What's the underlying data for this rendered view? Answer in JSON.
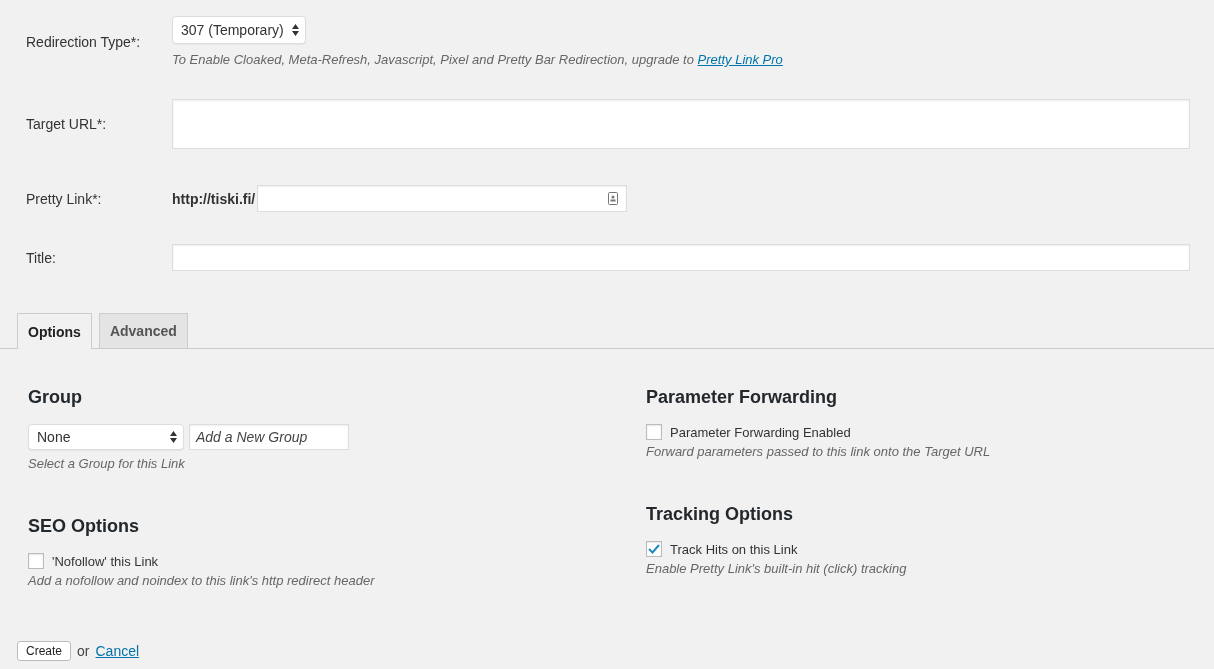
{
  "form": {
    "redirection_type": {
      "label": "Redirection Type*:",
      "value": "307 (Temporary)",
      "help": "To Enable Cloaked, Meta-Refresh, Javascript, Pixel and Pretty Bar Redirection, upgrade to",
      "help_link": "Pretty Link Pro"
    },
    "target_url": {
      "label": "Target URL*:"
    },
    "pretty_link": {
      "label": "Pretty Link*:",
      "prefix": "http://tiski.fi/"
    },
    "title": {
      "label": "Title:"
    }
  },
  "tabs": [
    {
      "label": "Options",
      "selected": true
    },
    {
      "label": "Advanced",
      "selected": false
    }
  ],
  "columns": [
    [
      {
        "kind": "group",
        "heading": "Group",
        "value": "None",
        "placeholder": "Add a New Group",
        "help": "Select a Group for this Link"
      },
      {
        "kind": "checkbox",
        "heading": "SEO Options",
        "label": "'Nofollow' this Link",
        "checked": false,
        "help": "Add a nofollow and noindex to this link's http redirect header"
      }
    ],
    [
      {
        "kind": "checkbox",
        "heading": "Parameter Forwarding",
        "label": "Parameter Forwarding Enabled",
        "checked": false,
        "help": "Forward parameters passed to this link onto the Target URL"
      },
      {
        "kind": "checkbox",
        "heading": "Tracking Options",
        "label": "Track Hits on this Link",
        "checked": true,
        "help": "Enable Pretty Link's built-in hit (click) tracking"
      }
    ]
  ],
  "actions": {
    "create": "Create",
    "or": "or",
    "cancel": "Cancel"
  }
}
